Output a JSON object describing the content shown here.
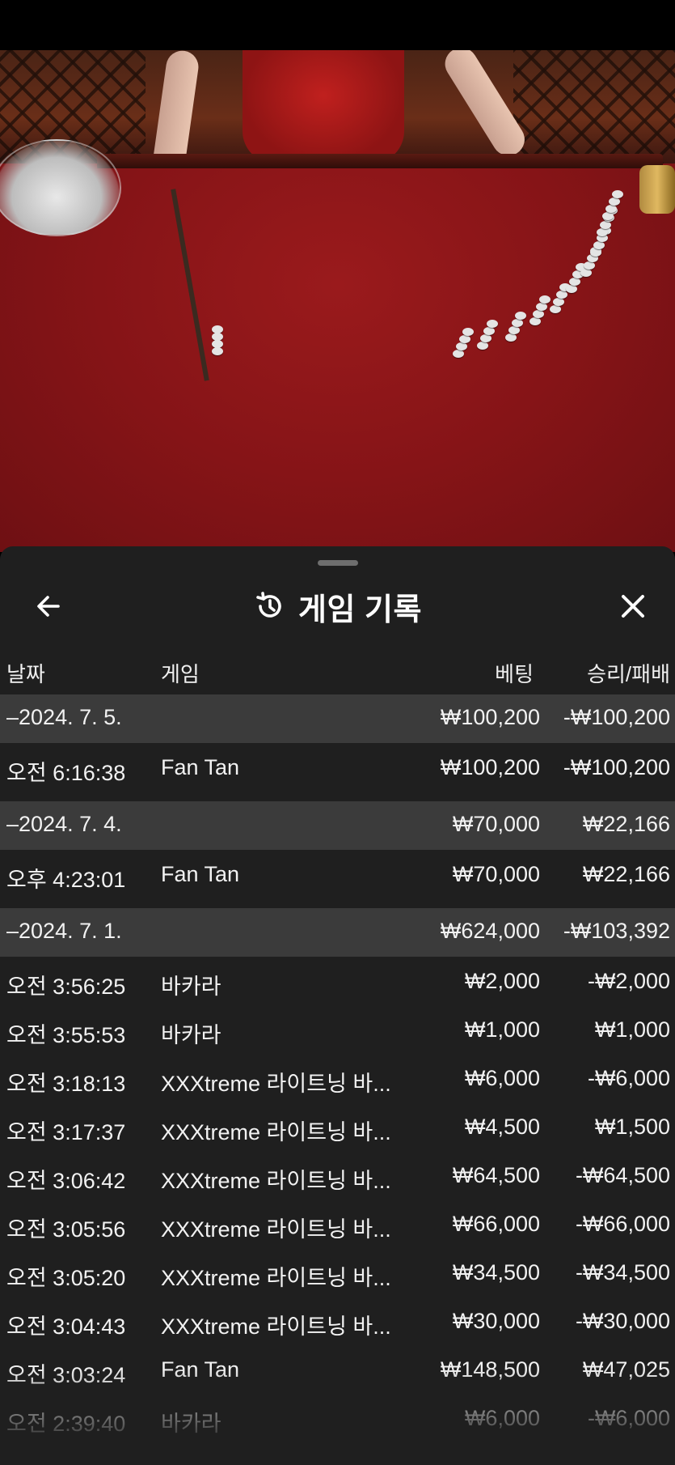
{
  "panel": {
    "title": "게임 기록",
    "icons": {
      "back": "arrow-left-icon",
      "history": "history-icon",
      "close": "close-icon"
    }
  },
  "columns": {
    "date": "날짜",
    "game": "게임",
    "bet": "베팅",
    "result": "승리/패배"
  },
  "groups": [
    {
      "date": "–2024. 7. 5.",
      "bet": "₩100,200",
      "result": "-₩100,200",
      "rows": [
        {
          "time": "오전 6:16:38",
          "game": "Fan Tan",
          "bet": "₩100,200",
          "result": "-₩100,200"
        }
      ]
    },
    {
      "date": "–2024. 7. 4.",
      "bet": "₩70,000",
      "result": "₩22,166",
      "rows": [
        {
          "time": "오후 4:23:01",
          "game": "Fan Tan",
          "bet": "₩70,000",
          "result": "₩22,166"
        }
      ]
    },
    {
      "date": "–2024. 7. 1.",
      "bet": "₩624,000",
      "result": "-₩103,392",
      "rows": [
        {
          "time": "오전 3:56:25",
          "game": "바카라",
          "bet": "₩2,000",
          "result": "-₩2,000"
        },
        {
          "time": "오전 3:55:53",
          "game": "바카라",
          "bet": "₩1,000",
          "result": "₩1,000"
        },
        {
          "time": "오전 3:18:13",
          "game": "XXXtreme 라이트닝 바...",
          "bet": "₩6,000",
          "result": "-₩6,000"
        },
        {
          "time": "오전 3:17:37",
          "game": "XXXtreme 라이트닝 바...",
          "bet": "₩4,500",
          "result": "₩1,500"
        },
        {
          "time": "오전 3:06:42",
          "game": "XXXtreme 라이트닝 바...",
          "bet": "₩64,500",
          "result": "-₩64,500"
        },
        {
          "time": "오전 3:05:56",
          "game": "XXXtreme 라이트닝 바...",
          "bet": "₩66,000",
          "result": "-₩66,000"
        },
        {
          "time": "오전 3:05:20",
          "game": "XXXtreme 라이트닝 바...",
          "bet": "₩34,500",
          "result": "-₩34,500"
        },
        {
          "time": "오전 3:04:43",
          "game": "XXXtreme 라이트닝 바...",
          "bet": "₩30,000",
          "result": "-₩30,000"
        },
        {
          "time": "오전 3:03:24",
          "game": "Fan Tan",
          "bet": "₩148,500",
          "result": "₩47,025"
        },
        {
          "time": "오전 2:39:40",
          "game": "바카라",
          "bet": "₩6,000",
          "result": "-₩6,000"
        }
      ]
    }
  ]
}
